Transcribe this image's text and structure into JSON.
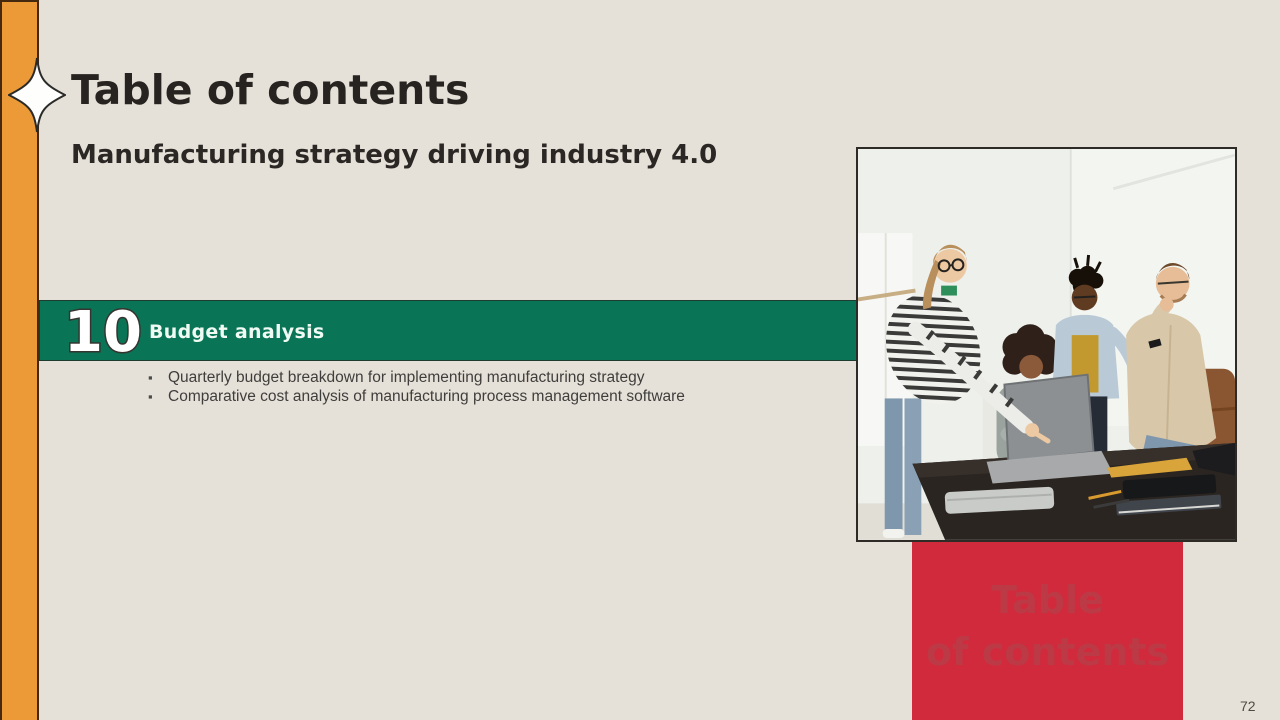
{
  "slide": {
    "title": "Table of contents",
    "subtitle": "Manufacturing strategy driving industry 4.0",
    "page_number": "72"
  },
  "section": {
    "number": "10",
    "heading": "Budget analysis",
    "bullets": [
      "Quarterly budget breakdown for implementing manufacturing strategy",
      "Comparative cost analysis of manufacturing process management software"
    ]
  },
  "watermark": {
    "line1": "Table",
    "line2": "of contents"
  },
  "photo": {
    "description": "team of four colleagues gathered around a laptop at a dark office table"
  },
  "colors": {
    "background": "#E6E1D8",
    "accent_orange": "#EC9A38",
    "accent_green": "#0A7456",
    "accent_red": "#D02A3C",
    "watermark_text": "#BC3A46",
    "heading_text": "#272320",
    "body_text": "#3F3E3C"
  }
}
